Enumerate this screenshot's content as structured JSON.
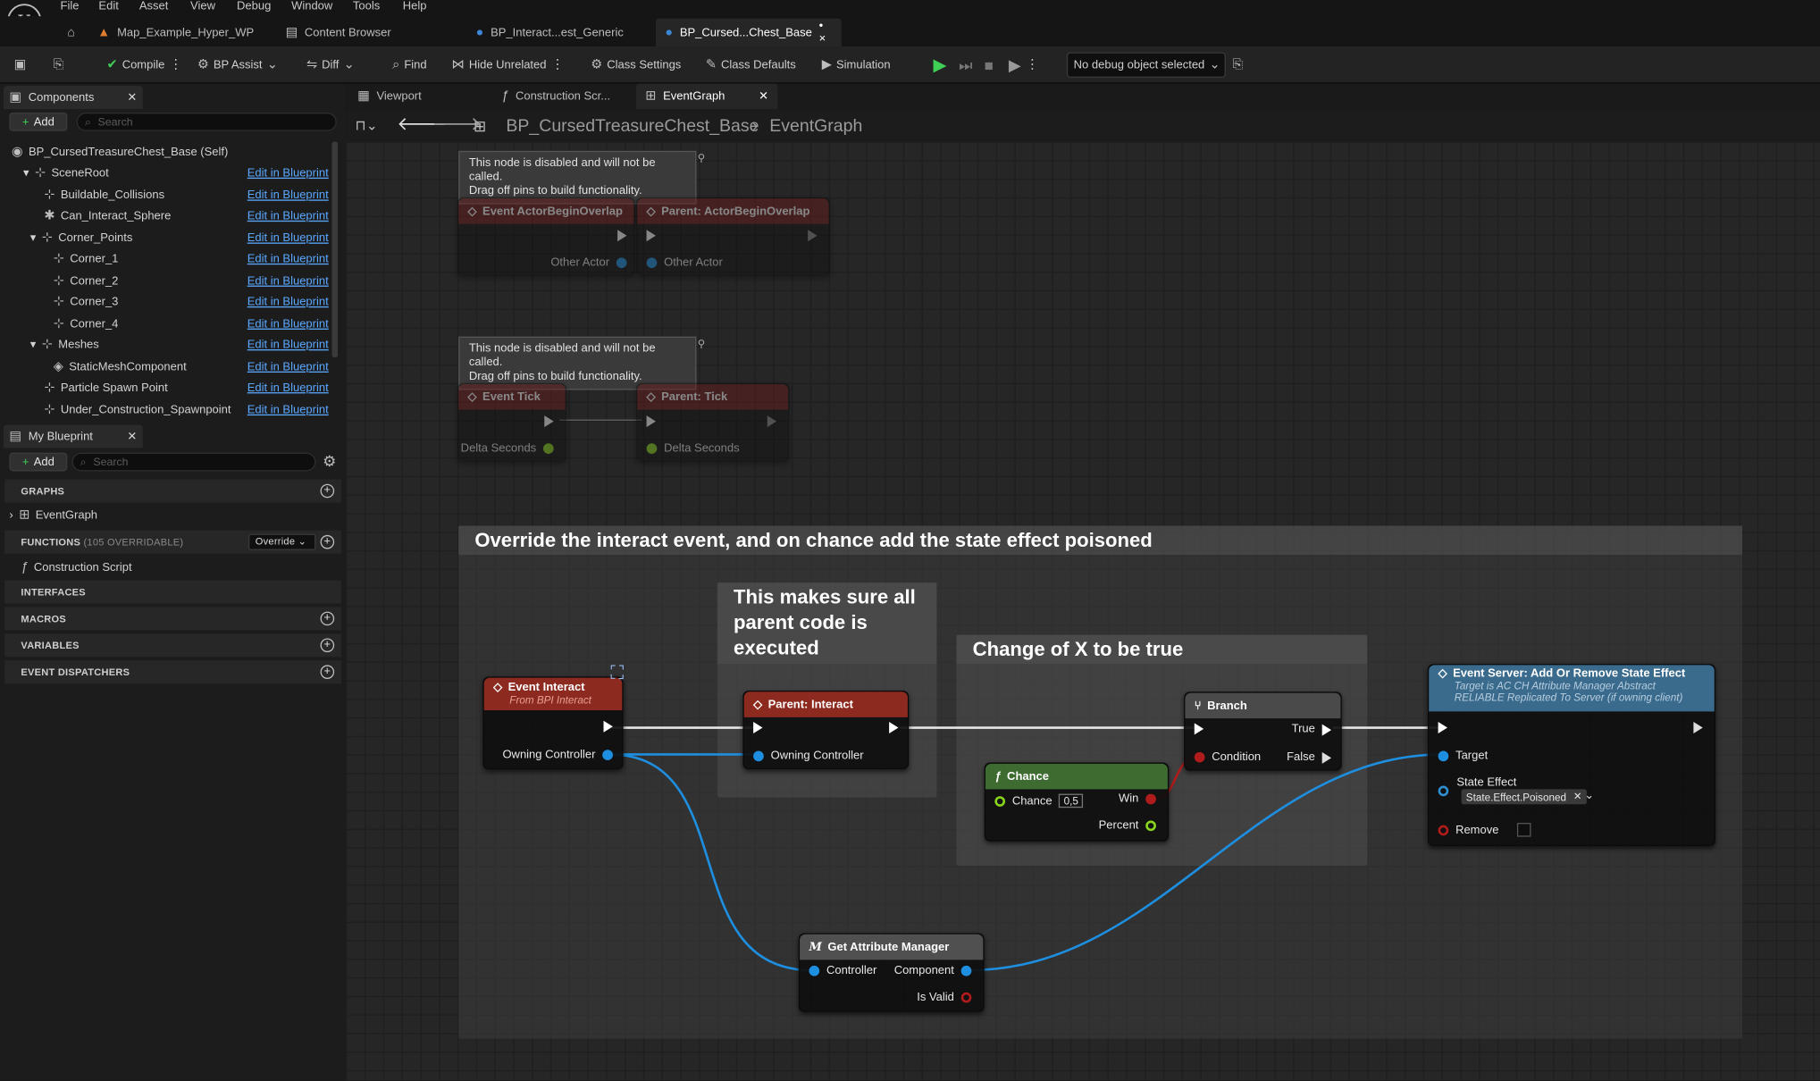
{
  "menu": [
    "File",
    "Edit",
    "Asset",
    "View",
    "Debug",
    "Window",
    "Tools",
    "Help"
  ],
  "doc_tabs": [
    {
      "label": "Map_Example_Hyper_WP"
    },
    {
      "label": "Content Browser"
    },
    {
      "label": "BP_Interact...est_Generic"
    },
    {
      "label": "BP_Cursed...Chest_Base",
      "suffix": "•  ×"
    }
  ],
  "toolbar": {
    "compile": "Compile",
    "bp_assist": "BP Assist",
    "diff": "Diff",
    "find": "Find",
    "hide_unrelated": "Hide Unrelated",
    "class_settings": "Class Settings",
    "class_defaults": "Class Defaults",
    "simulation": "Simulation",
    "debug_select": "No debug object selected"
  },
  "components_panel": {
    "tab": "Components",
    "add": "Add",
    "search_placeholder": "Search",
    "root": "BP_CursedTreasureChest_Base (Self)",
    "edit_label": "Edit in Blueprint",
    "items": [
      "SceneRoot",
      "Buildable_Collisions",
      "Can_Interact_Sphere",
      "Corner_Points",
      "Corner_1",
      "Corner_2",
      "Corner_3",
      "Corner_4",
      "Meshes",
      "StaticMeshComponent",
      "Particle Spawn Point",
      "Under_Construction_Spawnpoint"
    ]
  },
  "my_blueprint": {
    "tab": "My Blueprint",
    "add": "Add",
    "search_placeholder": "Search",
    "graphs": "GRAPHS",
    "event_graph": "EventGraph",
    "functions": "FUNCTIONS",
    "functions_count": "(105 OVERRIDABLE)",
    "override": "Override",
    "construction_script": "Construction Script",
    "interfaces": "INTERFACES",
    "macros": "MACROS",
    "variables": "VARIABLES",
    "event_dispatchers": "EVENT DISPATCHERS"
  },
  "graph_tabs": {
    "viewport": "Viewport",
    "construction": "Construction Scr...",
    "event_graph": "EventGraph"
  },
  "breadcrumb": {
    "blueprint": "BP_CursedTreasureChest_Base",
    "graph": "EventGraph"
  },
  "graph": {
    "disabled_tip_1": "This node is disabled and will not be called.",
    "disabled_tip_2": "Drag off pins to build functionality.",
    "begin_overlap": "Event ActorBeginOverlap",
    "parent_begin_overlap": "Parent: ActorBeginOverlap",
    "other_actor": "Other Actor",
    "event_tick": "Event Tick",
    "parent_tick": "Parent: Tick",
    "delta_seconds": "Delta Seconds",
    "comment_main": "Override the interact event, and on chance add the state effect poisoned",
    "comment_parent": "This makes sure all parent code is executed",
    "comment_change": "Change of X to be true",
    "event_interact": "Event Interact",
    "event_interact_sub": "From BPI Interact",
    "owning_controller": "Owning Controller",
    "parent_interact": "Parent: Interact",
    "branch": "Branch",
    "true": "True",
    "false": "False",
    "condition": "Condition",
    "chance": "Chance",
    "chance_val": "0,5",
    "win": "Win",
    "percent": "Percent",
    "server_event": "Event Server: Add Or Remove State Effect",
    "server_sub1": "Target is AC CH Attribute Manager Abstract",
    "server_sub2": "RELIABLE Replicated To Server (if owning client)",
    "target": "Target",
    "state_effect": "State Effect",
    "state_effect_val": "State.Effect.Poisoned",
    "remove": "Remove",
    "get_attr": "Get Attribute Manager",
    "controller": "Controller",
    "component": "Component",
    "is_valid": "Is Valid"
  }
}
